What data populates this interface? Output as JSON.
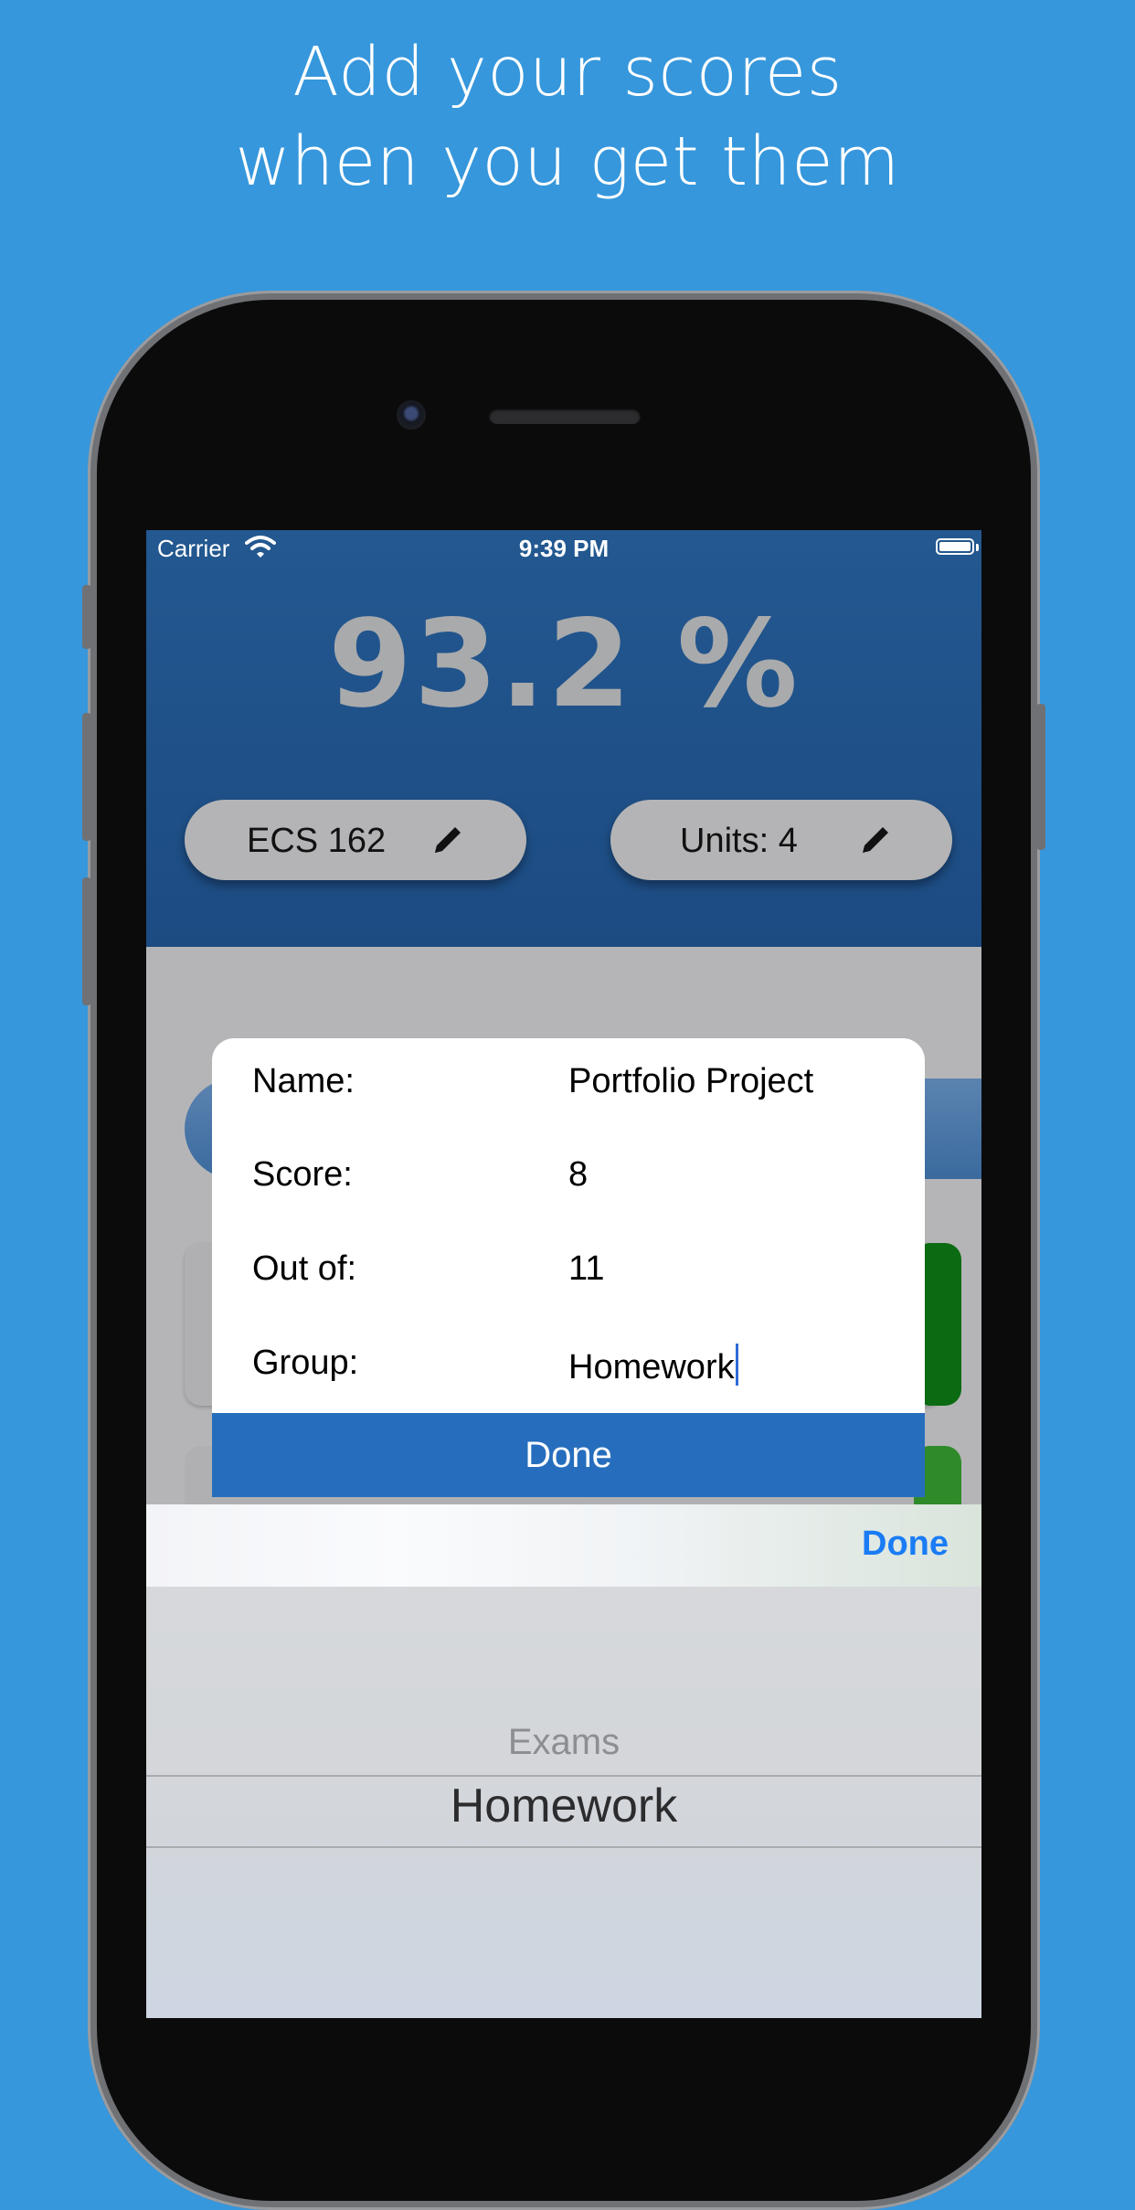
{
  "headline": {
    "line1": "Add your scores",
    "line2": "when you get them"
  },
  "status_bar": {
    "carrier": "Carrier",
    "time": "9:39 PM"
  },
  "grade": {
    "percent": "93.2 %"
  },
  "course": {
    "name": "ECS 162",
    "units": "Units: 4"
  },
  "score_form": {
    "name_label": "Name:",
    "name_value": "Portfolio Project",
    "score_label": "Score:",
    "score_value": "8",
    "out_of_label": "Out of:",
    "out_of_value": "11",
    "group_label": "Group:",
    "group_value": "Homework",
    "done_label": "Done"
  },
  "keyboard_toolbar": {
    "done_label": "Done"
  },
  "picker": {
    "options": [
      "Exams",
      "Homework"
    ],
    "selected": "Homework"
  },
  "colors": {
    "background": "#3697dc",
    "header": "#1f5087",
    "done_button": "#266ebd",
    "toolbar_done": "#1a7cf5",
    "card_green_dark": "#0b6b12",
    "card_green": "#2f8a2a"
  },
  "icons": [
    "wifi-icon",
    "battery-icon",
    "pencil-icon"
  ]
}
